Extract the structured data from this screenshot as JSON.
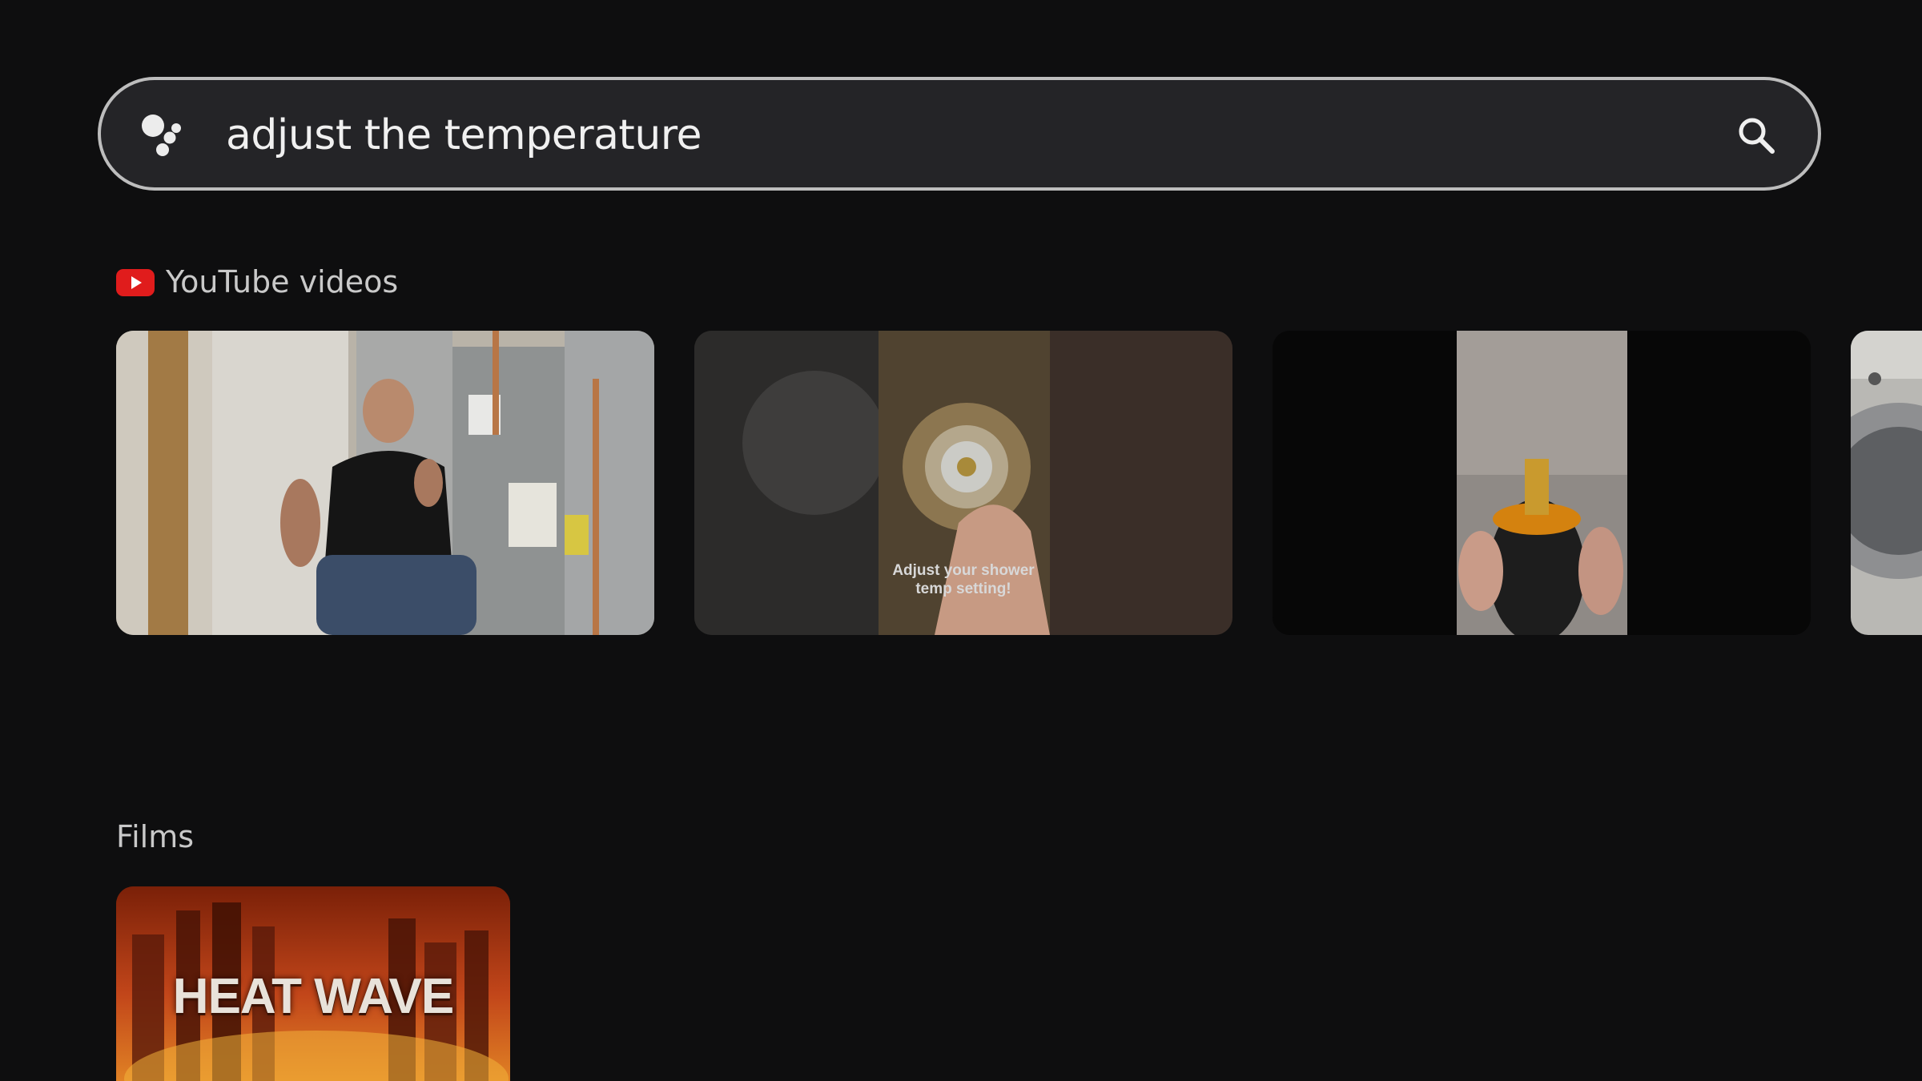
{
  "search": {
    "query": "adjust the temperature"
  },
  "sections": {
    "youtube": {
      "title": "YouTube videos",
      "videos": [
        {
          "id": "video-1"
        },
        {
          "id": "video-2",
          "caption": "Adjust your shower temp setting!"
        },
        {
          "id": "video-3"
        },
        {
          "id": "video-4"
        }
      ]
    },
    "films": {
      "title": "Films",
      "items": [
        {
          "title": "HEAT WAVE"
        }
      ]
    }
  },
  "icons": {
    "assistant": "google-assistant-icon",
    "search": "search-icon",
    "youtube": "youtube-logo-icon"
  },
  "colors": {
    "background": "#0e0e0f",
    "search_border": "#bdbdbd",
    "youtube_red": "#e01c1c"
  }
}
